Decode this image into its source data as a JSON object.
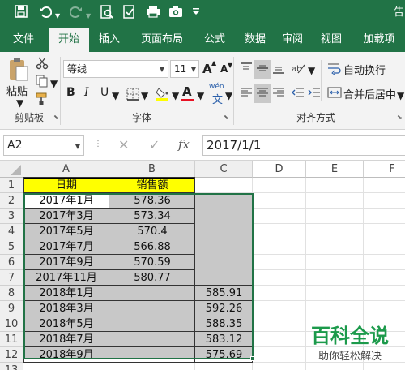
{
  "qat": {
    "right_text": "告"
  },
  "tabs": [
    "文件",
    "开始",
    "插入",
    "页面布局",
    "公式",
    "数据",
    "审阅",
    "视图",
    "加载项"
  ],
  "ribbon": {
    "paste_label": "粘贴",
    "clipboard_group": "剪贴板",
    "font_name": "等线",
    "font_size": "11",
    "grow_font": "A",
    "shrink_font": "A",
    "bold": "B",
    "italic": "I",
    "underline": "U",
    "font_color_letter": "A",
    "phonetic": "wén",
    "font_group": "字体",
    "wrap_text": "自动换行",
    "merge_center": "合并后居中",
    "align_group": "对齐方式"
  },
  "formula_bar": {
    "name_box": "A2",
    "fx": "fx",
    "value": "2017/1/1"
  },
  "columns": [
    "A",
    "B",
    "C",
    "D",
    "E",
    "F"
  ],
  "rows": [
    "1",
    "2",
    "3",
    "4",
    "5",
    "6",
    "7",
    "8",
    "9",
    "10",
    "11",
    "12",
    "13"
  ],
  "table": {
    "header": [
      "日期",
      "销售额"
    ],
    "rows": [
      {
        "date": "2017年1月",
        "b": "578.36",
        "c": ""
      },
      {
        "date": "2017年3月",
        "b": "573.34",
        "c": ""
      },
      {
        "date": "2017年5月",
        "b": "570.4",
        "c": ""
      },
      {
        "date": "2017年7月",
        "b": "566.88",
        "c": ""
      },
      {
        "date": "2017年9月",
        "b": "570.59",
        "c": ""
      },
      {
        "date": "2017年11月",
        "b": "580.77",
        "c": ""
      },
      {
        "date": "2018年1月",
        "b": "",
        "c": "585.91"
      },
      {
        "date": "2018年3月",
        "b": "",
        "c": "592.26"
      },
      {
        "date": "2018年5月",
        "b": "",
        "c": "588.35"
      },
      {
        "date": "2018年7月",
        "b": "",
        "c": "583.12"
      },
      {
        "date": "2018年9月",
        "b": "",
        "c": "575.69"
      }
    ]
  },
  "watermark": {
    "title": "百科全说",
    "subtitle": "助你轻松解决"
  },
  "colors": {
    "excel_green": "#217346",
    "header_yellow": "#ffff00",
    "selection_gray": "#c8c8c8",
    "font_red": "#e81123",
    "highlight_yellow": "#ffff00"
  }
}
